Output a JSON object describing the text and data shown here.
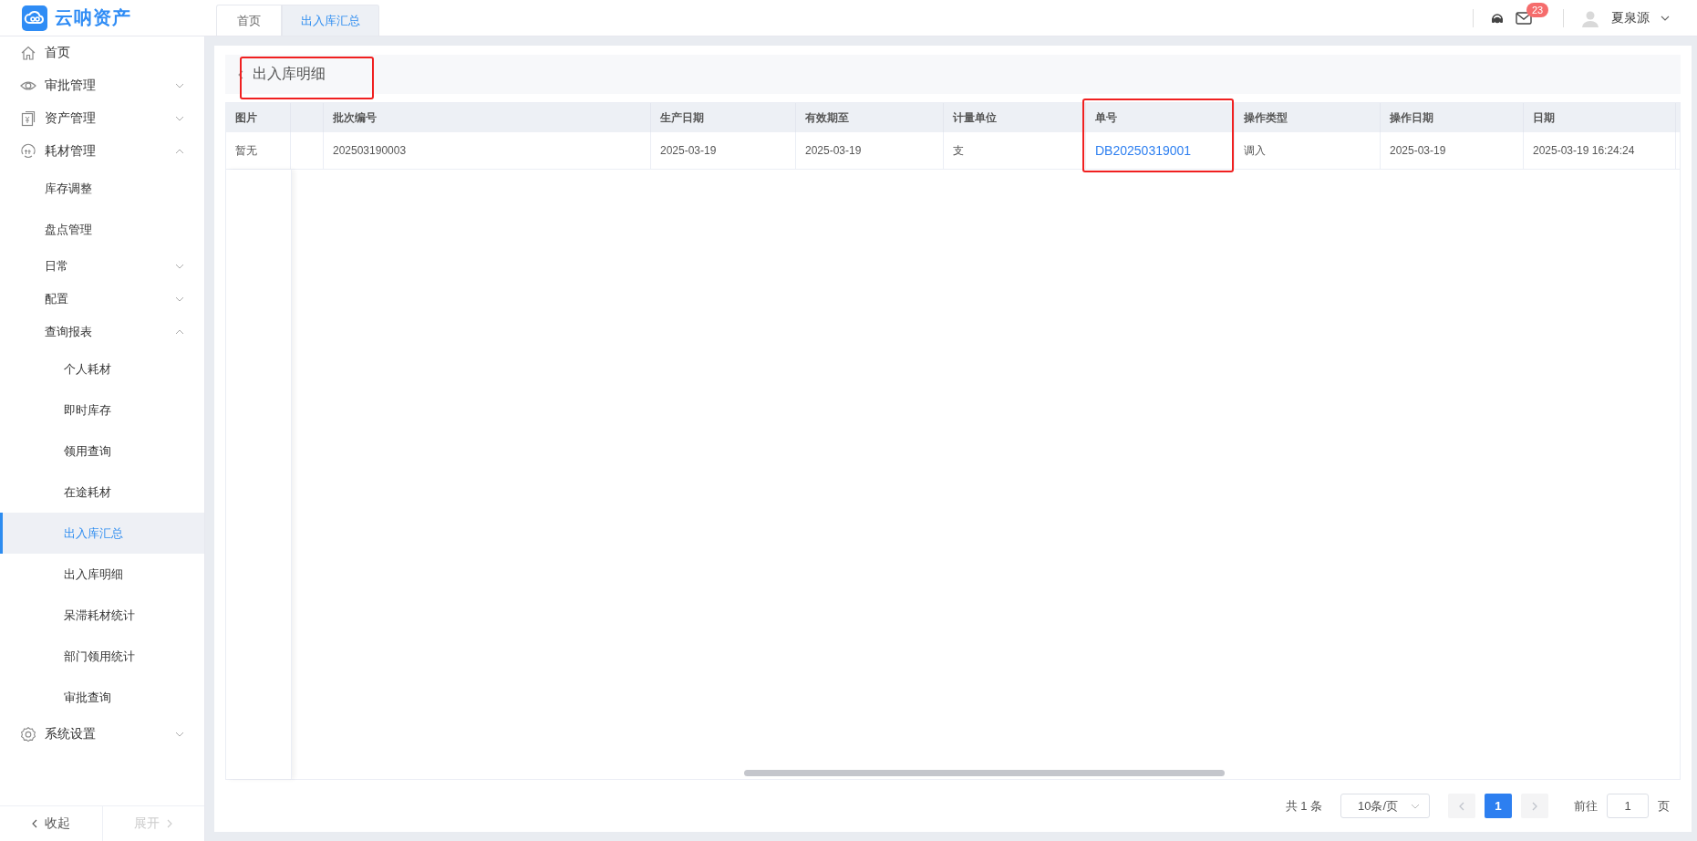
{
  "header": {
    "logo_text": "云呐资产",
    "tabs": [
      {
        "label": "首页",
        "selected": false
      },
      {
        "label": "出入库汇总",
        "selected": true
      }
    ],
    "mail_badge": "23",
    "user_name": "夏泉源"
  },
  "sidebar": {
    "items": [
      {
        "label": "首页",
        "selected": false
      },
      {
        "label": "审批管理",
        "selected": false,
        "expanded": false
      },
      {
        "label": "资产管理",
        "selected": false,
        "expanded": false
      },
      {
        "label": "耗材管理",
        "selected": false,
        "expanded": true,
        "children": [
          {
            "label": "库存调整",
            "selected": false
          },
          {
            "label": "盘点管理",
            "selected": false
          },
          {
            "label": "日常",
            "selected": false,
            "expanded": false
          },
          {
            "label": "配置",
            "selected": false,
            "expanded": false
          },
          {
            "label": "查询报表",
            "selected": false,
            "expanded": true,
            "children": [
              {
                "label": "个人耗材",
                "selected": false
              },
              {
                "label": "即时库存",
                "selected": false
              },
              {
                "label": "领用查询",
                "selected": false
              },
              {
                "label": "在途耗材",
                "selected": false
              },
              {
                "label": "出入库汇总",
                "selected": true
              },
              {
                "label": "出入库明细",
                "selected": false
              },
              {
                "label": "呆滞耗材统计",
                "selected": false
              },
              {
                "label": "部门领用统计",
                "selected": false
              },
              {
                "label": "审批查询",
                "selected": false
              }
            ]
          }
        ]
      },
      {
        "label": "系统设置",
        "selected": false,
        "expanded": false
      }
    ],
    "footer": [
      {
        "label": "收起",
        "disabled": false
      },
      {
        "label": "展开",
        "disabled": true
      }
    ]
  },
  "page": {
    "back_title": "出入库明细"
  },
  "table": {
    "columns": [
      {
        "label": "图片",
        "kind": "text"
      },
      {
        "label": "批次编号",
        "kind": "text"
      },
      {
        "label": "生产日期",
        "kind": "text"
      },
      {
        "label": "有效期至",
        "kind": "text"
      },
      {
        "label": "计量单位",
        "kind": "text"
      },
      {
        "label": "单号",
        "kind": "link"
      },
      {
        "label": "操作类型",
        "kind": "text"
      },
      {
        "label": "操作日期",
        "kind": "text"
      },
      {
        "label": "日期",
        "kind": "text"
      }
    ],
    "rows": [
      [
        "暂无",
        "202503190003",
        "2025-03-19",
        "2025-03-19",
        "支",
        "DB20250319001",
        "调入",
        "2025-03-19",
        "2025-03-19 16:24:24"
      ]
    ]
  },
  "pagination": {
    "total": "共 1 条",
    "page_size": "10条/页",
    "prev_disabled": true,
    "next_disabled": true,
    "pages": [
      {
        "label": "1",
        "selected": true
      }
    ],
    "goto_label": "前往",
    "goto_value": "1",
    "goto_suffix": "页"
  }
}
